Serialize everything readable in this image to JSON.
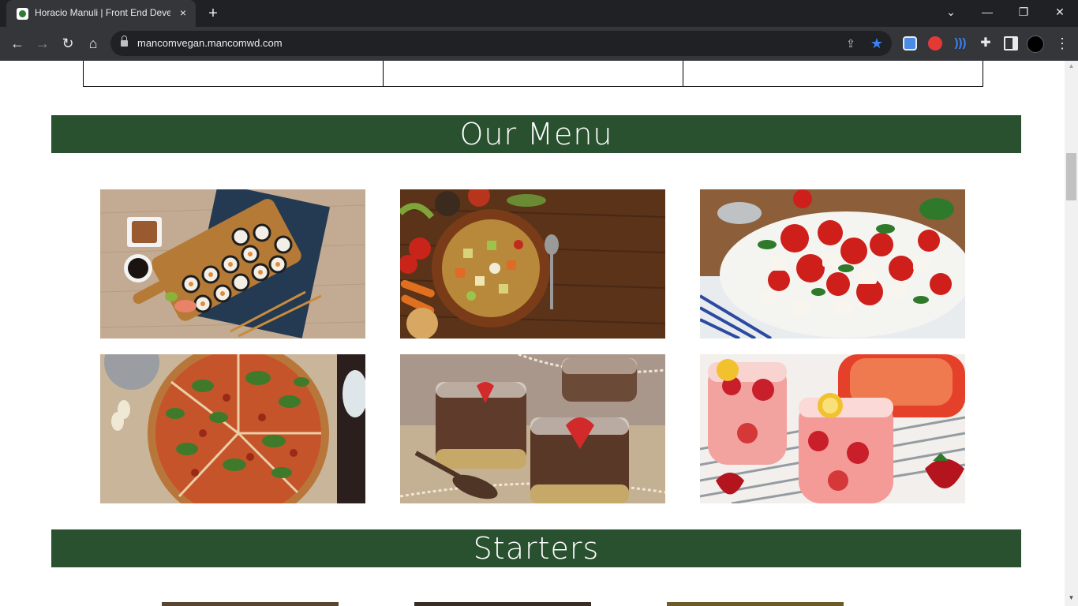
{
  "browser": {
    "tab_title": "Horacio Manuli | Front End Deve",
    "url": "mancomvegan.mancomwd.com",
    "icons": {
      "tab_close": "×",
      "new_tab": "+",
      "tab_search": "⌄",
      "minimize": "—",
      "maximize": "❐",
      "close": "✕",
      "back": "←",
      "forward": "→",
      "reload": "↻",
      "home": "⌂",
      "share": "⇪",
      "star": "★",
      "extensions": "✚",
      "menu": "⋮"
    }
  },
  "page": {
    "menu_heading": "Our Menu",
    "starters_heading": "Starters",
    "menu_items": [
      {
        "image": "sushi-rolls-photo"
      },
      {
        "image": "vegetable-soup-photo"
      },
      {
        "image": "tomato-mozzarella-salad-photo"
      },
      {
        "image": "vegan-pizza-photo"
      },
      {
        "image": "chocolate-pudding-strawberry-photo"
      },
      {
        "image": "strawberry-sangria-photo"
      }
    ]
  },
  "colors": {
    "banner_green": "#29512f",
    "chrome_dark": "#202124",
    "chrome_toolbar": "#35363a",
    "star_blue": "#3b82f6"
  }
}
